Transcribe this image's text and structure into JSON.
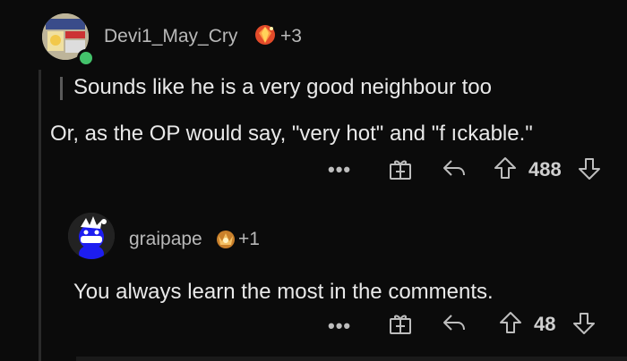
{
  "comment": {
    "username": "Devi1_May_Cry",
    "flair_count": "+3",
    "quote": "Sounds like he is a very good neighbour too",
    "body": "Or, as the OP would say, \"very hot\" and \"f ıckable.\"",
    "more_label": "•••",
    "votes": "488"
  },
  "reply": {
    "username": "graipape",
    "flair_count": "+1",
    "body": "You always learn the most in the comments.",
    "more_label": "•••",
    "votes": "48"
  },
  "colors": {
    "background": "#0b0b0b",
    "text": "#e9e9e9",
    "muted": "#b9b9b9",
    "online": "#43c26b"
  }
}
